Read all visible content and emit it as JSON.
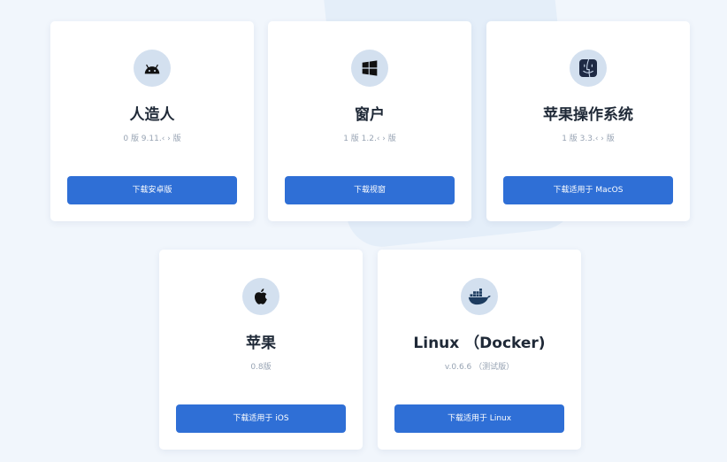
{
  "cards": [
    {
      "icon": "android-icon",
      "title": "人造人",
      "version": "0 版 9.11.‹ › 版",
      "button": "下载安卓版"
    },
    {
      "icon": "windows-icon",
      "title": "窗户",
      "version": "1 版 1.2.‹ › 版",
      "button": "下载视窗"
    },
    {
      "icon": "macos-finder-icon",
      "title": "苹果操作系统",
      "version": "1 版 3.3.‹ › 版",
      "button": "下载适用于 MacOS"
    },
    {
      "icon": "apple-icon",
      "title": "苹果",
      "version": "0.8版",
      "button": "下载适用于 iOS"
    },
    {
      "icon": "docker-icon",
      "title": "Linux （Docker)",
      "version": "v.0.6.6 （测试版）",
      "button": "下载适用于 Linux"
    }
  ],
  "colors": {
    "page_background": "#f1f6fc",
    "card_background": "#ffffff",
    "icon_circle": "#d3e0ef",
    "button": "#2f6fd6",
    "title": "#1f2937",
    "version": "#97a3b3"
  }
}
